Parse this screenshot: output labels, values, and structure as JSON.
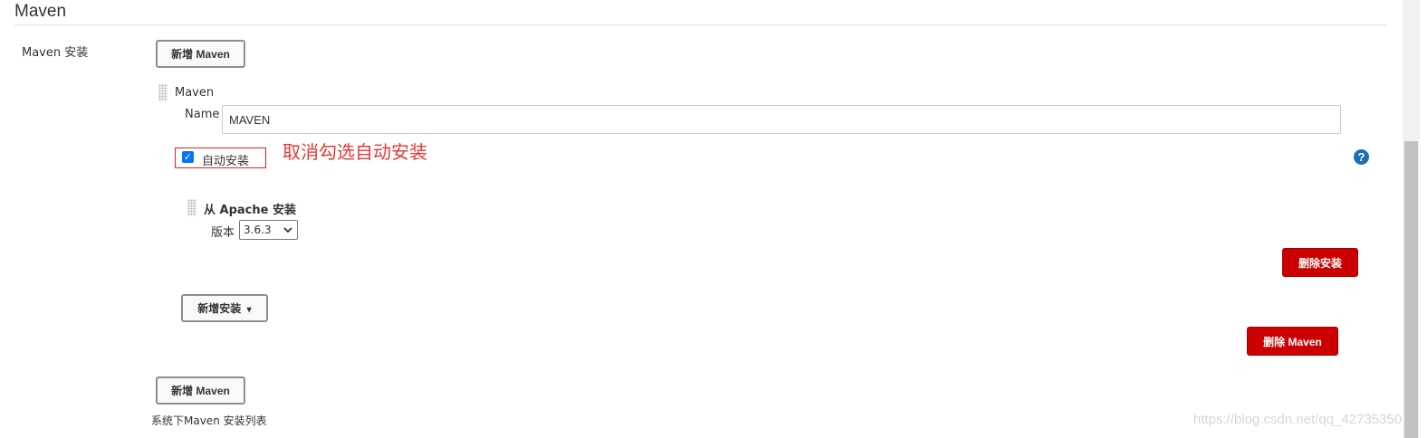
{
  "section": {
    "title": "Maven"
  },
  "maven_install": {
    "label": "Maven 安装",
    "add_button_top": "新增 Maven",
    "item": {
      "header": "Maven",
      "name_label": "Name",
      "name_value": "MAVEN",
      "auto_install": {
        "label": "自动安装",
        "checked": true
      },
      "installer": {
        "title": "从 Apache 安装",
        "version_label": "版本",
        "version_value": "3.6.3",
        "delete_installer_button": "删除安装"
      },
      "add_installer_button": "新增安装",
      "delete_maven_button": "删除 Maven"
    },
    "add_button_bottom": "新增 Maven",
    "description": "系统下Maven 安装列表"
  },
  "annotation": {
    "text": "取消勾选自动安装",
    "color": "#e53935"
  },
  "icons": {
    "help": "help-icon",
    "checkbox_check": "✓",
    "dropdown": "chevron-down-icon",
    "caret": "▾",
    "help_glyph": "?"
  },
  "colors": {
    "danger": "#cc0000",
    "checkbox": "#0075ff",
    "help": "#1e6eb0"
  },
  "watermark": "https://blog.csdn.net/qq_42735350"
}
